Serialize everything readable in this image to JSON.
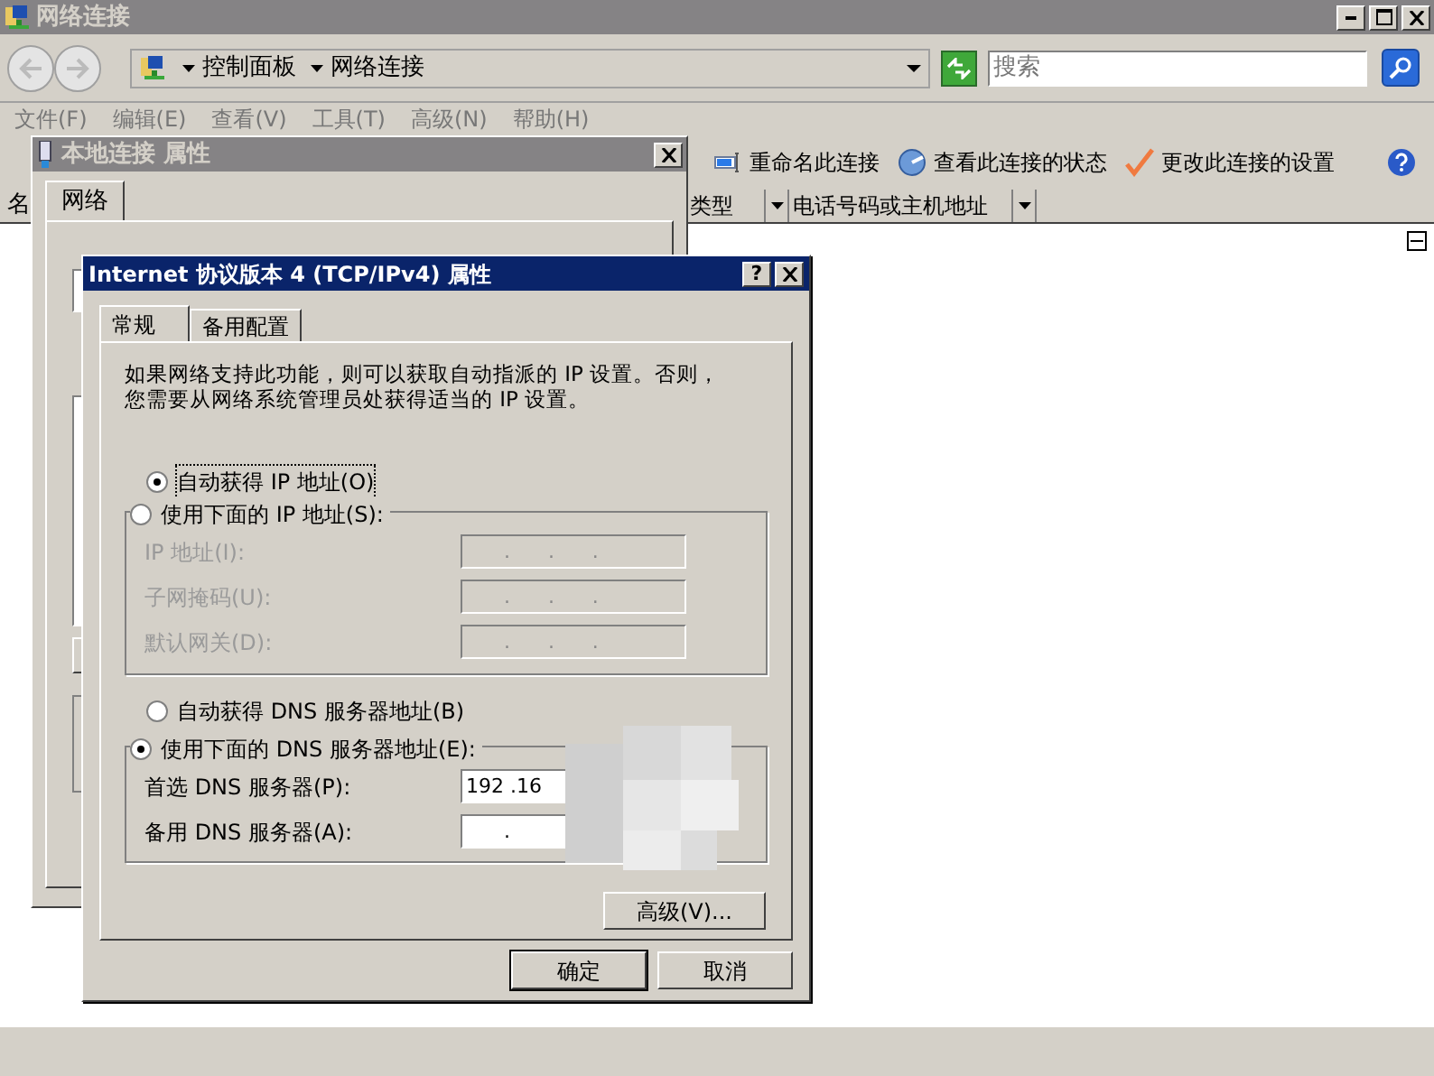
{
  "window": {
    "title": "网络连接"
  },
  "address_bar": {
    "breadcrumbs": [
      "控制面板",
      "网络连接"
    ]
  },
  "search": {
    "placeholder": "搜索"
  },
  "menu": [
    "文件(F)",
    "编辑(E)",
    "查看(V)",
    "工具(T)",
    "高级(N)",
    "帮助(H)"
  ],
  "commands": [
    {
      "label": "重命名此连接",
      "kind": "rename"
    },
    {
      "label": "查看此连接的状态",
      "kind": "status"
    },
    {
      "label": "更改此连接的设置",
      "kind": "settings"
    }
  ],
  "columns": [
    "名",
    "类型",
    "电话号码或主机地址"
  ],
  "back_dialog": {
    "title": "本地连接 属性",
    "tabs": [
      {
        "label": "网络",
        "selected": true
      }
    ]
  },
  "dialog": {
    "title": "Internet 协议版本 4 (TCP/IPv4) 属性",
    "help_button": "?",
    "tabs": [
      {
        "label": "常规",
        "selected": true
      },
      {
        "label": "备用配置",
        "selected": false
      }
    ],
    "description": "如果网络支持此功能，则可以获取自动指派的 IP 设置。否则，您需要从网络系统管理员处获得适当的 IP 设置。",
    "ip_options": [
      {
        "label": "自动获得 IP 地址(O)",
        "selected": true
      },
      {
        "label": "使用下面的 IP 地址(S):",
        "selected": false
      }
    ],
    "ip_fields": [
      {
        "label": "IP 地址(I):",
        "value": "      .      .      .",
        "disabled": true
      },
      {
        "label": "子网掩码(U):",
        "value": "      .      .      .",
        "disabled": true
      },
      {
        "label": "默认网关(D):",
        "value": "      .      .      .",
        "disabled": true
      }
    ],
    "dns_options": [
      {
        "label": "自动获得 DNS 服务器地址(B)",
        "selected": false
      },
      {
        "label": "使用下面的 DNS 服务器地址(E):",
        "selected": true
      }
    ],
    "dns_fields": [
      {
        "label": "首选 DNS 服务器(P):",
        "value": "192 .16",
        "disabled": false
      },
      {
        "label": "备用 DNS 服务器(A):",
        "value": "      .",
        "disabled": false
      }
    ],
    "advanced_button": "高级(V)...",
    "buttons": [
      {
        "label": "确定",
        "default": true
      },
      {
        "label": "取消",
        "default": false
      }
    ]
  }
}
